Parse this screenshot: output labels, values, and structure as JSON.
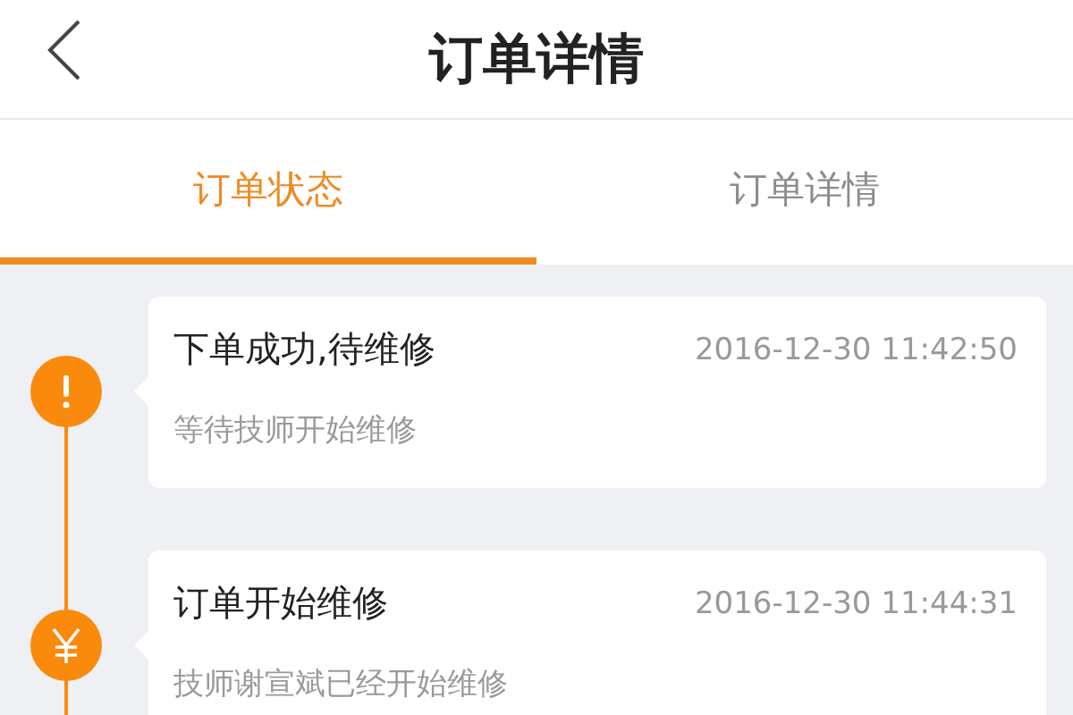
{
  "header": {
    "title": "订单详情"
  },
  "tabs": [
    {
      "label": "订单状态",
      "selected": true
    },
    {
      "label": "订单详情",
      "selected": false
    }
  ],
  "timeline": [
    {
      "kind": "alert",
      "title": "下单成功,待维修",
      "time": "2016-12-30 11:42:50",
      "description": "等待技师开始维修"
    },
    {
      "kind": "payment",
      "title": "订单开始维修",
      "time": "2016-12-30 11:44:31",
      "description": "技师谢宣斌已经开始维修"
    }
  ]
}
